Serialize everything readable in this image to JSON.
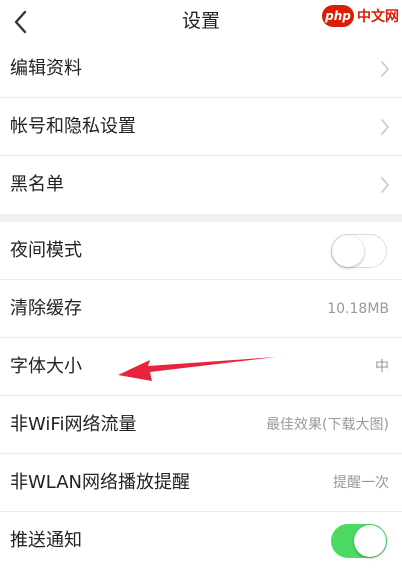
{
  "header": {
    "title": "设置",
    "back_icon": "chevron-left-icon"
  },
  "watermark": {
    "logo": "php",
    "text": "中文网"
  },
  "group1": {
    "items": [
      {
        "label": "编辑资料"
      },
      {
        "label": "帐号和隐私设置"
      },
      {
        "label": "黑名单"
      }
    ]
  },
  "group2": {
    "items": [
      {
        "label": "夜间模式",
        "toggle": false
      },
      {
        "label": "清除缓存",
        "value": "10.18MB"
      },
      {
        "label": "字体大小",
        "value": "中"
      },
      {
        "label": "非WiFi网络流量",
        "value": "最佳效果(下载大图)"
      },
      {
        "label": "非WLAN网络播放提醒",
        "value": "提醒一次"
      },
      {
        "label": "推送通知",
        "toggle": true
      }
    ]
  },
  "colors": {
    "toggle_on": "#4cd964",
    "annotation_arrow": "#e8243c",
    "watermark": "#d81e06"
  }
}
